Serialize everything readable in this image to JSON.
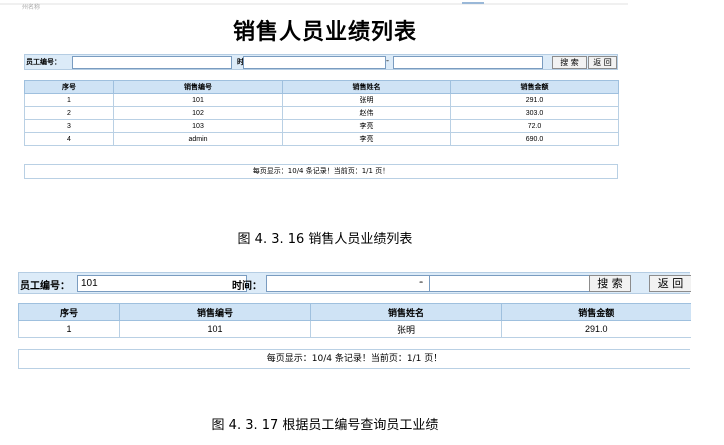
{
  "header": {
    "page_title": "销售人员业绩列表",
    "tiny_label": "州名称"
  },
  "figure1": {
    "search": {
      "emp_id_label": "员工编号：",
      "emp_id_value": "",
      "time_label": "时间：",
      "time_from": "",
      "range_sep": "--",
      "time_to": "",
      "search_button": "搜 索",
      "back_button": "返 回"
    },
    "table": {
      "columns": [
        "序号",
        "销售编号",
        "销售姓名",
        "销售金额"
      ],
      "rows": [
        [
          "1",
          "101",
          "张明",
          "291.0"
        ],
        [
          "2",
          "102",
          "赵伟",
          "303.0"
        ],
        [
          "3",
          "103",
          "李亮",
          "72.0"
        ],
        [
          "4",
          "admin",
          "李亮",
          "690.0"
        ]
      ]
    },
    "pager": "每页显示：10/4 条记录！当前页：1/1 页！",
    "caption": "图 4. 3. 16 销售人员业绩列表"
  },
  "figure2": {
    "search": {
      "emp_id_label": "员工编号：",
      "emp_id_value": "101",
      "time_label": "时间：",
      "time_from": "",
      "range_sep": "--",
      "time_to": "",
      "search_button": "搜 索",
      "back_button": "返 回"
    },
    "table": {
      "columns": [
        "序号",
        "销售编号",
        "销售姓名",
        "销售金额"
      ],
      "rows": [
        [
          "1",
          "101",
          "张明",
          "291.0"
        ]
      ]
    },
    "pager": "每页显示：10/4 条记录！当前页：1/1 页！",
    "caption": "图 4. 3. 17 根据员工编号查询员工业绩"
  },
  "colors": {
    "header_bg": "#cfe3f5",
    "bar_bg": "#dcebf8",
    "border": "#9fc0de"
  }
}
